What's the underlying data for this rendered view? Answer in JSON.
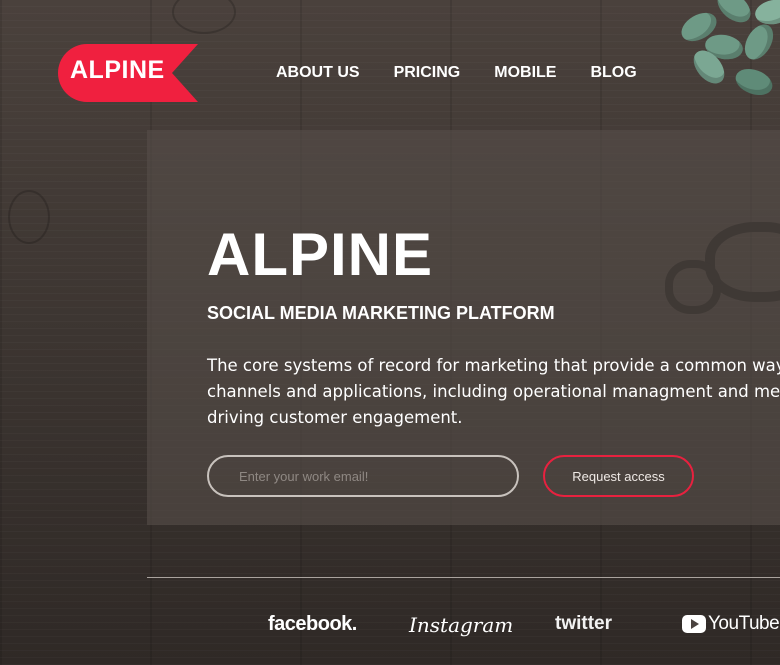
{
  "brand": {
    "name": "ALPINE",
    "accent": "#f0203f"
  },
  "nav": {
    "items": [
      "ABOUT US",
      "PRICING",
      "MOBILE",
      "BLOG"
    ]
  },
  "hero": {
    "title": "ALPINE",
    "subtitle": "SOCIAL MEDIA MARKETING PLATFORM",
    "description_lines": [
      "The core systems of record for marketing that provide a common way of",
      "channels and applications, including operational managment and measu",
      "driving customer engagement."
    ],
    "email_placeholder": "Enter your work email!",
    "request_label": "Request access"
  },
  "social": {
    "facebook": "facebook.",
    "instagram": "Instagram",
    "twitter": "twitter",
    "youtube": "YouTube"
  }
}
